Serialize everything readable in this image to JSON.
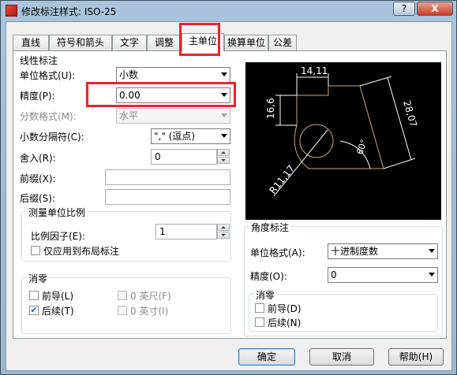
{
  "window": {
    "title": "修改标注样式: ISO-25",
    "help_symbol": "?",
    "close_symbol": "X"
  },
  "tabs": [
    "直线",
    "符号和箭头",
    "文字",
    "调整",
    "主单位",
    "换算单位",
    "公差"
  ],
  "linear": {
    "group_title": "线性标注",
    "unit_format_label": "单位格式(U):",
    "unit_format_value": "小数",
    "precision_label": "精度(P):",
    "precision_value": "0.00",
    "fraction_format_label": "分数格式(M):",
    "fraction_format_value": "水平",
    "decimal_separator_label": "小数分隔符(C):",
    "decimal_separator_value": "\",\"  (逗点)",
    "round_off_label": "舍入(R):",
    "round_off_value": "0",
    "prefix_label": "前缀(X):",
    "suffix_label": "后缀(S):"
  },
  "scale": {
    "group_title": "测量单位比例",
    "factor_label": "比例因子(E):",
    "factor_value": "1",
    "layout_only_label": "仅应用到布局标注"
  },
  "zero_left": {
    "group_title": "消零",
    "leading_label": "前导(L)",
    "trailing_label": "后续(T)",
    "feet_label": "0 英尺(F)",
    "inches_label": "0 英寸(I)",
    "trailing_checked": true
  },
  "preview": {
    "dim_top": "14,11",
    "dim_left": "16,6",
    "dim_right": "28,07",
    "dim_angle": "60°",
    "dim_radius": "R11,17"
  },
  "angular": {
    "group_title": "角度标注",
    "unit_format_label": "单位格式(A):",
    "unit_format_value": "十进制度数",
    "precision_label": "精度(O):",
    "precision_value": "0",
    "zero_group_title": "消零",
    "leading_label": "前导(D)",
    "trailing_label": "后续(N)"
  },
  "buttons": {
    "ok": "确定",
    "cancel": "取消",
    "help": "帮助(H)"
  }
}
